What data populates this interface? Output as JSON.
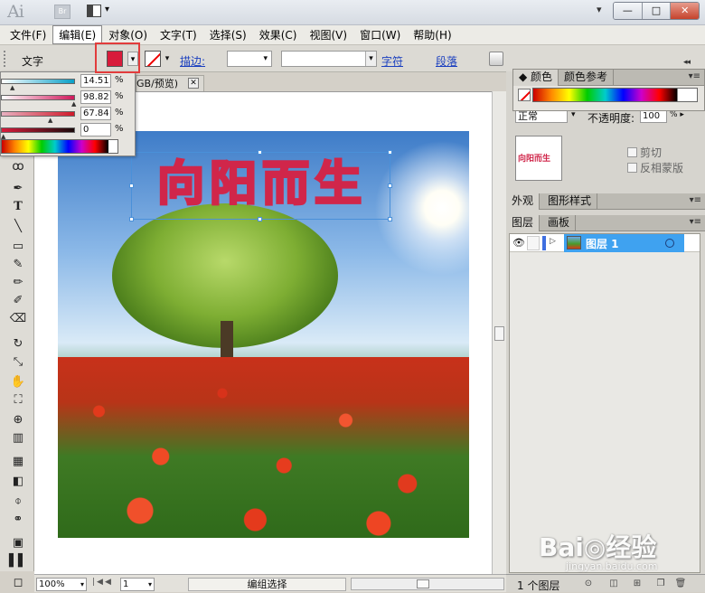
{
  "window": {
    "app_logo": "Ai",
    "bridge_badge": "Br",
    "controls": [
      "—",
      "□",
      "✕"
    ],
    "workspace_dd": "▾"
  },
  "menu": [
    "文件(F)",
    "编辑(E)",
    "对象(O)",
    "文字(T)",
    "选择(S)",
    "效果(C)",
    "视图(V)",
    "窗口(W)",
    "帮助(H)"
  ],
  "control_bar": {
    "label": "文字",
    "stroke_label": "描边:",
    "char_link": "字符",
    "para_link": "段落",
    "fill_color": "#d81b3b"
  },
  "color_popup": {
    "sliders": [
      {
        "value": "14.51",
        "unit": "%"
      },
      {
        "value": "98.82",
        "unit": "%"
      },
      {
        "value": "67.84",
        "unit": "%"
      },
      {
        "value": "0",
        "unit": "%"
      }
    ]
  },
  "document": {
    "tab_title": "GB/预览)",
    "artwork_text": "向阳而生",
    "zoom": "100%",
    "page": "1",
    "status": "编组选择"
  },
  "panels": {
    "color_tabs": [
      "颜色",
      "颜色参考"
    ],
    "blend_mode": "正常",
    "opacity_label": "不透明度:",
    "opacity_value": "100",
    "opacity_unit": "%",
    "clip_label": "剪切",
    "invert_mask_label": "反相蒙版",
    "preview_text": "向阳而生",
    "appearance_tabs": [
      "外观",
      "图形样式"
    ],
    "layers_tabs": [
      "图层",
      "画板"
    ],
    "layer_name": "图层 1",
    "layers_count": "1 个图层"
  },
  "watermark": {
    "main": "Bai◎经验",
    "sub": "jingyan.baidu.com"
  }
}
